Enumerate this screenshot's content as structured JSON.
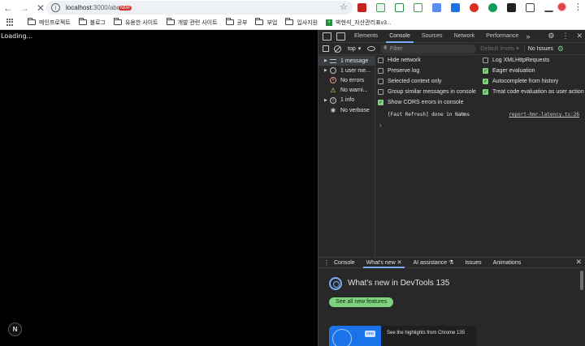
{
  "browser": {
    "url_host": "localhost",
    "url_path": ":3000/abc",
    "bookmarks": [
      {
        "label": "메인프로젝트",
        "type": "folder"
      },
      {
        "label": "블로그",
        "type": "folder"
      },
      {
        "label": "유용한 사이트",
        "type": "folder"
      },
      {
        "label": "개발 관련 사이트",
        "type": "folder"
      },
      {
        "label": "공부",
        "type": "folder"
      },
      {
        "label": "부업",
        "type": "folder"
      },
      {
        "label": "입사지원",
        "type": "folder"
      },
      {
        "label": "박현석_자산관리표v3...",
        "type": "sheet"
      }
    ],
    "new_badge": "NEW"
  },
  "page": {
    "loading_text": "Loading...",
    "next_badge": "N"
  },
  "devtools": {
    "tabs": [
      "Elements",
      "Console",
      "Sources",
      "Network",
      "Performance"
    ],
    "active_tab": "Console",
    "context": "top",
    "filter_placeholder": "Filter",
    "levels": "Default levels",
    "issues": "No Issues",
    "sidebar": [
      {
        "label": "1 message",
        "icon": "list-icon",
        "expandable": true
      },
      {
        "label": "1 user me...",
        "icon": "user-icon",
        "expandable": true
      },
      {
        "label": "No errors",
        "icon": "error-icon",
        "expandable": false
      },
      {
        "label": "No warni...",
        "icon": "warning-icon",
        "expandable": false
      },
      {
        "label": "1 info",
        "icon": "info-icon",
        "expandable": true
      },
      {
        "label": "No verbose",
        "icon": "verbose-icon",
        "expandable": false
      }
    ],
    "settings_left": [
      {
        "label": "Hide network",
        "checked": false
      },
      {
        "label": "Preserve log",
        "checked": false
      },
      {
        "label": "Selected context only",
        "checked": false
      },
      {
        "label": "Group similar messages in console",
        "checked": false
      },
      {
        "label": "Show CORS errors in console",
        "checked": true
      }
    ],
    "settings_right": [
      {
        "label": "Log XMLHttpRequests",
        "checked": false
      },
      {
        "label": "Eager evaluation",
        "checked": true
      },
      {
        "label": "Autocomplete from history",
        "checked": true
      },
      {
        "label": "Treat code evaluation as user action",
        "checked": true
      }
    ],
    "log": {
      "message": "[Fast Refresh] done in NaNms",
      "source": "report-hmr-latency.ts:26"
    },
    "drawer": {
      "tabs": [
        "Console",
        "What's new",
        "AI assistance",
        "Issues",
        "Animations"
      ],
      "active_tab": "What's new",
      "whatsnew_title": "What's new in DevTools 135",
      "see_all": "See all new features",
      "card_text": "See the highlights from Chrome 135",
      "card_badge": "new"
    }
  }
}
